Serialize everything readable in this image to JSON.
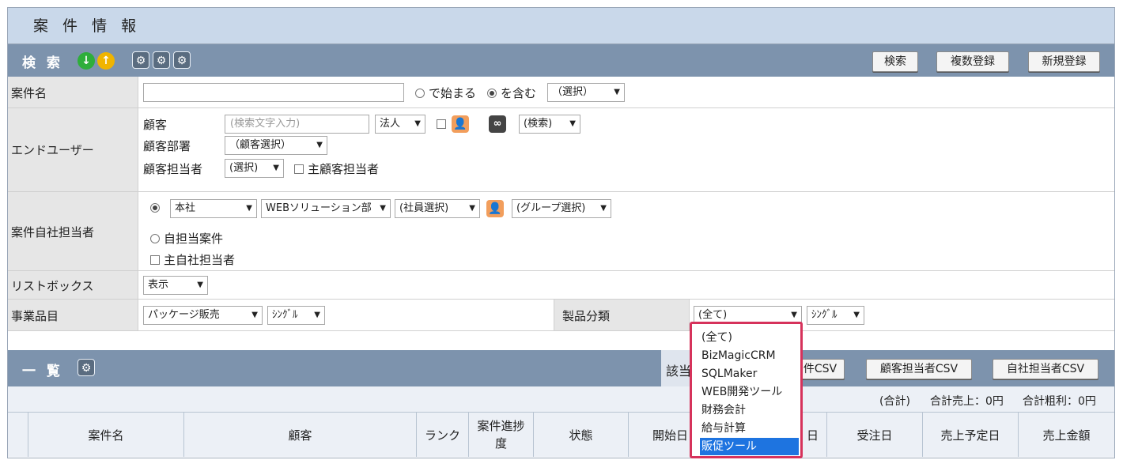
{
  "page": {
    "title": "案 件 情 報"
  },
  "search_bar": {
    "title": "検 索",
    "buttons": {
      "search": "検索",
      "multi_register": "複数登録",
      "new_register": "新規登録"
    },
    "icons": [
      "arrow-down-icon",
      "arrow-up-icon",
      "gear-icon",
      "gear-search-icon",
      "gear-edit-icon"
    ]
  },
  "form": {
    "case_name": {
      "label": "案件名",
      "value": "",
      "option_starts": "で始まる",
      "option_contains": "を含む",
      "select": "（選択）"
    },
    "end_user": {
      "label": "エンドユーザー",
      "customer_label": "顧客",
      "customer_placeholder": "(検索文字入力)",
      "corp_select": "法人",
      "search_select": "(検索)",
      "dept_label": "顧客部署",
      "dept_select": "（顧客選択）",
      "staff_label": "顧客担当者",
      "staff_select": "(選択)",
      "main_staff_label": "主顧客担当者"
    },
    "own_staff": {
      "label": "案件自社担当者",
      "office_select": "本社",
      "dept_select": "WEBソリューション部",
      "employee_select": "(社員選択)",
      "group_select": "(グループ選択)",
      "self_cases_label": "自担当案件",
      "main_own_staff_label": "主自社担当者"
    },
    "listbox": {
      "label": "リストボックス",
      "select": "表示"
    },
    "business_item": {
      "label": "事業品目",
      "select": "パッケージ販売",
      "mode_select": "ｼﾝｸﾞﾙ",
      "product_label": "製品分類",
      "product_select": "(全て)",
      "product_mode_select": "ｼﾝｸﾞﾙ"
    }
  },
  "product_dropdown": {
    "options": [
      "(全て)",
      "BizMagicCRM",
      "SQLMaker",
      "WEB開発ツール",
      "財務会計",
      "給与計算",
      "販促ツール"
    ],
    "highlighted": "販促ツール"
  },
  "list_bar": {
    "title": "一 覧",
    "hits_label": "該当",
    "buttons": {
      "case_csv": "件CSV",
      "customer_staff_csv": "顧客担当者CSV",
      "own_staff_csv": "自社担当者CSV"
    }
  },
  "summary": {
    "label": "(合計)",
    "total_sales": "合計売上：0円",
    "total_profit": "合計粗利：0円"
  },
  "table": {
    "columns": [
      "案件名",
      "顧客",
      "ランク",
      "案件進捗度",
      "状態",
      "開始日",
      "日",
      "受注日",
      "売上予定日",
      "売上金額"
    ]
  },
  "colors": {
    "header_bg": "#7d93ad",
    "title_bg": "#c9d8ea",
    "dropdown_border": "#d6325b",
    "highlight": "#1e74e0"
  }
}
